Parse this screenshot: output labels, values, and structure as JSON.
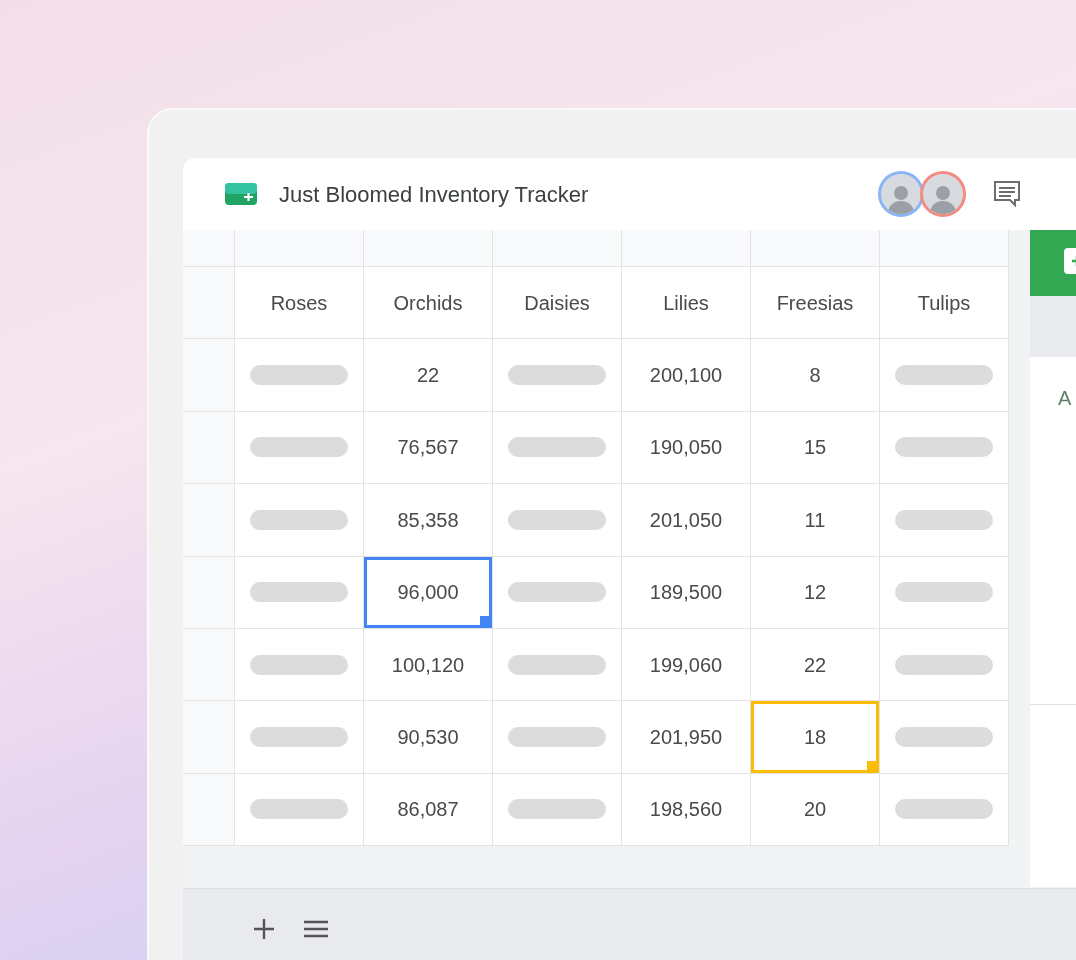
{
  "window": {
    "title": "Just Bloomed Inventory Tracker"
  },
  "collaborators": [
    {
      "color": "#8ab4f8"
    },
    {
      "color": "#f28b82"
    }
  ],
  "table": {
    "columns": [
      "Roses",
      "Orchids",
      "Daisies",
      "Lilies",
      "Freesias",
      "Tulips"
    ],
    "rows": [
      {
        "cells": [
          {
            "kind": "placeholder",
            "selected": false
          },
          {
            "kind": "text",
            "text": "22",
            "selected": false
          },
          {
            "kind": "placeholder",
            "selected": false
          },
          {
            "kind": "text",
            "text": "200,100",
            "selected": false
          },
          {
            "kind": "text",
            "text": "8",
            "selected": false
          },
          {
            "kind": "placeholder",
            "selected": false
          }
        ]
      },
      {
        "cells": [
          {
            "kind": "placeholder",
            "selected": false
          },
          {
            "kind": "text",
            "text": "76,567",
            "selected": false
          },
          {
            "kind": "placeholder",
            "selected": false
          },
          {
            "kind": "text",
            "text": "190,050",
            "selected": false
          },
          {
            "kind": "text",
            "text": "15",
            "selected": false
          },
          {
            "kind": "placeholder",
            "selected": false
          }
        ]
      },
      {
        "cells": [
          {
            "kind": "placeholder",
            "selected": false
          },
          {
            "kind": "text",
            "text": "85,358",
            "selected": false
          },
          {
            "kind": "placeholder",
            "selected": false
          },
          {
            "kind": "text",
            "text": "201,050",
            "selected": false
          },
          {
            "kind": "text",
            "text": "11",
            "selected": false
          },
          {
            "kind": "placeholder",
            "selected": false
          }
        ]
      },
      {
        "cells": [
          {
            "kind": "placeholder",
            "selected": false
          },
          {
            "kind": "text",
            "text": "96,000",
            "selected": true,
            "color": "#4285f4"
          },
          {
            "kind": "placeholder",
            "selected": false
          },
          {
            "kind": "text",
            "text": "189,500",
            "selected": false
          },
          {
            "kind": "text",
            "text": "12",
            "selected": false
          },
          {
            "kind": "placeholder",
            "selected": false
          }
        ]
      },
      {
        "cells": [
          {
            "kind": "placeholder",
            "selected": false
          },
          {
            "kind": "text",
            "text": "100,120",
            "selected": false
          },
          {
            "kind": "placeholder",
            "selected": false
          },
          {
            "kind": "text",
            "text": "199,060",
            "selected": false
          },
          {
            "kind": "text",
            "text": "22",
            "selected": false
          },
          {
            "kind": "placeholder",
            "selected": false
          }
        ]
      },
      {
        "cells": [
          {
            "kind": "placeholder",
            "selected": false
          },
          {
            "kind": "text",
            "text": "90,530",
            "selected": false
          },
          {
            "kind": "placeholder",
            "selected": false
          },
          {
            "kind": "text",
            "text": "201,950",
            "selected": false
          },
          {
            "kind": "text",
            "text": "18",
            "selected": true,
            "color": "#fbbc04"
          },
          {
            "kind": "placeholder",
            "selected": false
          }
        ]
      },
      {
        "cells": [
          {
            "kind": "placeholder",
            "selected": false
          },
          {
            "kind": "text",
            "text": "86,087",
            "selected": false
          },
          {
            "kind": "placeholder",
            "selected": false
          },
          {
            "kind": "text",
            "text": "198,560",
            "selected": false
          },
          {
            "kind": "text",
            "text": "20",
            "selected": false
          },
          {
            "kind": "placeholder",
            "selected": false
          }
        ]
      }
    ]
  },
  "side_panel": {
    "text": "A"
  }
}
